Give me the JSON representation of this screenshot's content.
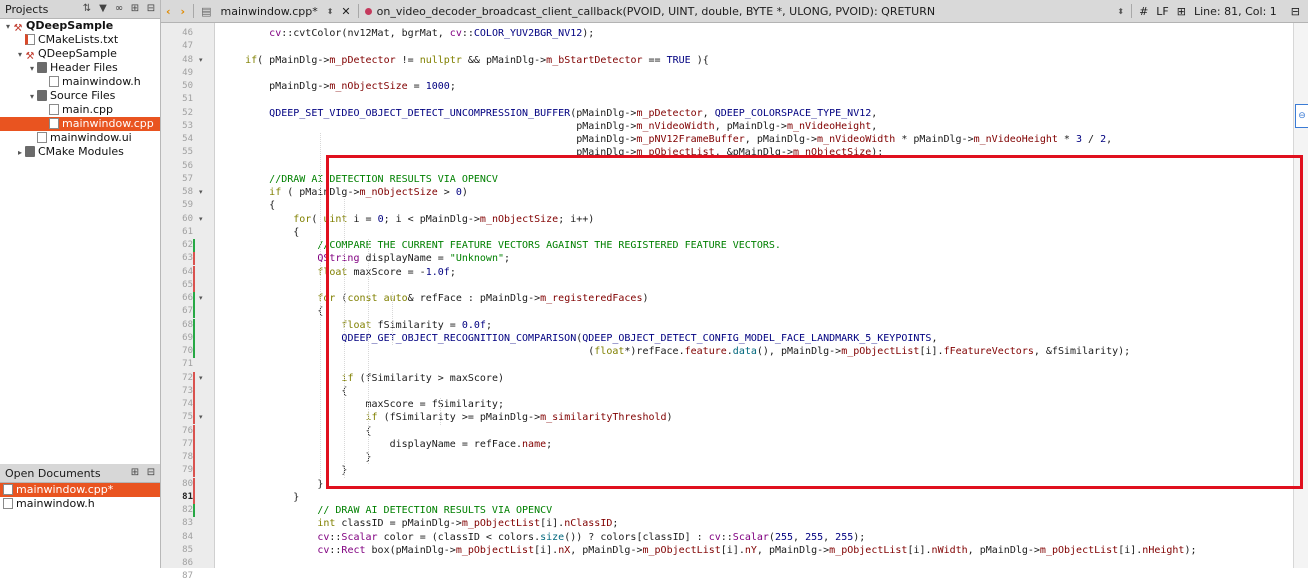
{
  "sidebar": {
    "title": "Projects",
    "tree": [
      {
        "label": "QDeepSample",
        "indent": 0,
        "arrow": "▾",
        "icon": "proj",
        "bold": true
      },
      {
        "label": "CMakeLists.txt",
        "indent": 1,
        "arrow": "",
        "icon": "cmake"
      },
      {
        "label": "QDeepSample",
        "indent": 1,
        "arrow": "▾",
        "icon": "proj"
      },
      {
        "label": "Header Files",
        "indent": 2,
        "arrow": "▾",
        "icon": "folder"
      },
      {
        "label": "mainwindow.h",
        "indent": 3,
        "arrow": "",
        "icon": "doc"
      },
      {
        "label": "Source Files",
        "indent": 2,
        "arrow": "▾",
        "icon": "folder"
      },
      {
        "label": "main.cpp",
        "indent": 3,
        "arrow": "",
        "icon": "doc"
      },
      {
        "label": "mainwindow.cpp",
        "indent": 3,
        "arrow": "",
        "icon": "doc",
        "selected": true
      },
      {
        "label": "mainwindow.ui",
        "indent": 2,
        "arrow": "",
        "icon": "doc"
      },
      {
        "label": "CMake Modules",
        "indent": 1,
        "arrow": "▸",
        "icon": "folder"
      }
    ],
    "open_docs_title": "Open Documents",
    "open_docs": [
      {
        "label": "mainwindow.cpp*",
        "selected": true
      },
      {
        "label": "mainwindow.h",
        "selected": false
      }
    ]
  },
  "toolbar": {
    "file_name": "mainwindow.cpp*",
    "function_path": "on_video_decoder_broadcast_client_callback(PVOID, UINT, double, BYTE *, ULONG, PVOID): QRETURN",
    "hash": "#",
    "line_ending": "LF",
    "position": "Line: 81, Col: 1"
  },
  "colors": {
    "highlight_box": "#e0101e",
    "selection": "#e95420",
    "change_red": "#d9534f",
    "change_green": "#27a844"
  },
  "editor": {
    "current_line": 81,
    "lines": [
      {
        "n": 46,
        "html": "        <span class='nsp'>cv</span>::cvtColor(nv12Mat, bgrMat, <span class='nsp'>cv</span>::<span class='mac'>COLOR_YUV2BGR_NV12</span>);"
      },
      {
        "n": 47,
        "html": ""
      },
      {
        "n": 48,
        "fold": true,
        "html": "    <span class='k'>if</span>( pMainDlg-><span class='mem'>m_pDetector</span> != <span class='k'>nullptr</span> &amp;&amp; pMainDlg-><span class='mem'>m_bStartDetector</span> == <span class='mac'>TRUE</span> ){"
      },
      {
        "n": 49,
        "html": ""
      },
      {
        "n": 50,
        "html": "        pMainDlg-><span class='mem'>m_nObjectSize</span> = <span class='num'>1000</span>;"
      },
      {
        "n": 51,
        "html": ""
      },
      {
        "n": 52,
        "html": "        <span class='mac'>QDEEP_SET_VIDEO_OBJECT_DETECT_UNCOMPRESSION_BUFFER</span>(pMainDlg-><span class='mem'>m_pDetector</span>, <span class='mac'>QDEEP_COLORSPACE_TYPE_NV12</span>,"
      },
      {
        "n": 53,
        "html": "                                                           pMainDlg-><span class='mem'>m_nVideoWidth</span>, pMainDlg-><span class='mem'>m_nVideoHeight</span>,"
      },
      {
        "n": 54,
        "html": "                                                           pMainDlg-><span class='mem'>m_pNV12FrameBuffer</span>, pMainDlg-><span class='mem'>m_nVideoWidth</span> * pMainDlg-><span class='mem'>m_nVideoHeight</span> * <span class='num'>3</span> / <span class='num'>2</span>,"
      },
      {
        "n": 55,
        "html": "                                                           pMainDlg-><span class='mem'>m_pObjectList</span>, &amp;pMainDlg-><span class='mem'>m_nObjectSize</span>);"
      },
      {
        "n": 56,
        "html": ""
      },
      {
        "n": 57,
        "html": "        <span class='cm'>//DRAW AI DETECTION RESULTS VIA OPENCV</span>"
      },
      {
        "n": 58,
        "fold": true,
        "html": "        <span class='k'>if</span> ( pMainDlg-><span class='mem'>m_nObjectSize</span> > <span class='num'>0</span>)"
      },
      {
        "n": 59,
        "html": "        {"
      },
      {
        "n": 60,
        "fold": true,
        "html": "            <span class='k'>for</span>( <span class='k'>uint</span> i = <span class='num'>0</span>; i &lt; pMainDlg-><span class='mem'>m_nObjectSize</span>; i++)"
      },
      {
        "n": 61,
        "html": "            {"
      },
      {
        "n": 62,
        "chg": "green",
        "html": "                <span class='cm'>//COMPARE THE CURRENT FEATURE VECTORS AGAINST THE REGISTERED FEATURE VECTORS.</span>"
      },
      {
        "n": 63,
        "chg": "red",
        "html": "                <span class='ty'>QString</span> displayName = <span class='str'>\"Unknown\"</span>;"
      },
      {
        "n": 64,
        "chg": "red",
        "html": "                <span class='k'>float</span> maxScore = -<span class='num'>1.0f</span>;"
      },
      {
        "n": 65,
        "chg": "red",
        "html": ""
      },
      {
        "n": 66,
        "fold": true,
        "chg": "green",
        "html": "                <span class='k'>for</span> (<span class='k'>const</span> <span class='k'>auto</span>&amp; refFace : pMainDlg-><span class='mem'>m_registeredFaces</span>)"
      },
      {
        "n": 67,
        "chg": "green",
        "html": "                {"
      },
      {
        "n": 68,
        "chg": "green",
        "html": "                    <span class='k'>float</span> fSimilarity = <span class='num'>0.0f</span>;"
      },
      {
        "n": 69,
        "chg": "green",
        "html": "                    <span class='mac'>QDEEP_GET_OBJECT_RECOGNITION_COMPARISON</span>(<span class='mac'>QDEEP_OBJECT_DETECT_CONFIG_MODEL_FACE_LANDMARK_5_KEYPOINTS</span>,"
      },
      {
        "n": 70,
        "chg": "green",
        "html": "                                                             (<span class='k'>float</span>*)refFace.<span class='mem'>feature</span>.<span class='fn'>data</span>(), pMainDlg-><span class='mem'>m_pObjectList</span>[i].<span class='mem'>fFeatureVectors</span>, &amp;fSimilarity);"
      },
      {
        "n": 71,
        "html": ""
      },
      {
        "n": 72,
        "fold": true,
        "chg": "red",
        "html": "                    <span class='k'>if</span> (fSimilarity > maxScore)"
      },
      {
        "n": 73,
        "chg": "red",
        "html": "                    {"
      },
      {
        "n": 74,
        "chg": "red",
        "html": "                        maxScore = fSimilarity;"
      },
      {
        "n": 75,
        "fold": true,
        "chg": "red",
        "html": "                        <span class='k'>if</span> (fSimilarity >= pMainDlg-><span class='mem'>m_similarityThreshold</span>)"
      },
      {
        "n": 76,
        "chg": "red",
        "html": "                        {"
      },
      {
        "n": 77,
        "chg": "red",
        "html": "                            displayName = refFace.<span class='mem'>name</span>;"
      },
      {
        "n": 78,
        "chg": "red",
        "html": "                        }"
      },
      {
        "n": 79,
        "chg": "red",
        "html": "                    }"
      },
      {
        "n": 80,
        "chg": "red",
        "html": "                }"
      },
      {
        "n": 81,
        "chg": "red",
        "html": "            }"
      },
      {
        "n": 82,
        "chg": "green",
        "html": "                <span class='cm'>// DRAW AI DETECTION RESULTS VIA OPENCV</span>"
      },
      {
        "n": 83,
        "html": "                <span class='k'>int</span> classID = pMainDlg-><span class='mem'>m_pObjectList</span>[i].<span class='mem'>nClassID</span>;"
      },
      {
        "n": 84,
        "html": "                <span class='nsp'>cv</span>::<span class='ty'>Scalar</span> color = (classID &lt; colors.<span class='fn'>size</span>()) ? colors[classID] : <span class='nsp'>cv</span>::<span class='ty'>Scalar</span>(<span class='num'>255</span>, <span class='num'>255</span>, <span class='num'>255</span>);"
      },
      {
        "n": 85,
        "html": "                <span class='nsp'>cv</span>::<span class='ty'>Rect</span> box(pMainDlg-><span class='mem'>m_pObjectList</span>[i].<span class='mem'>nX</span>, pMainDlg-><span class='mem'>m_pObjectList</span>[i].<span class='mem'>nY</span>, pMainDlg-><span class='mem'>m_pObjectList</span>[i].<span class='mem'>nWidth</span>, pMainDlg-><span class='mem'>m_pObjectList</span>[i].<span class='mem'>nHeight</span>);"
      },
      {
        "n": 86,
        "html": ""
      },
      {
        "n": 87,
        "html": "                <span class='cm'>//...</span>"
      }
    ]
  }
}
